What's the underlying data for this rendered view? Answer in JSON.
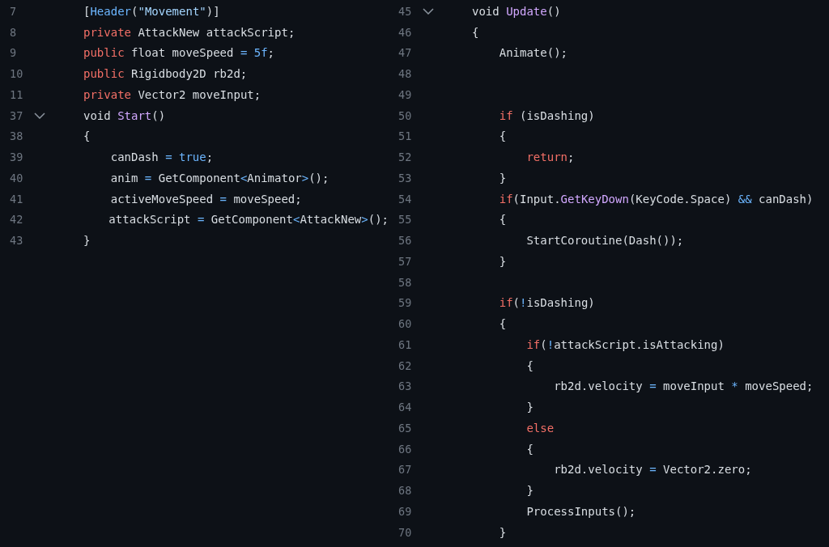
{
  "panes": [
    {
      "lines": [
        {
          "number": "7",
          "tokens": [
            {
              "kind": "plain",
              "text": "["
            },
            {
              "kind": "type",
              "text": "Header"
            },
            {
              "kind": "plain",
              "text": "("
            },
            {
              "kind": "string",
              "text": "\"Movement\""
            },
            {
              "kind": "plain",
              "text": ")]"
            }
          ]
        },
        {
          "number": "8",
          "tokens": [
            {
              "kind": "keyword",
              "text": "private"
            },
            {
              "kind": "plain",
              "text": " AttackNew attackScript;"
            }
          ]
        },
        {
          "number": "9",
          "tokens": [
            {
              "kind": "keyword",
              "text": "public"
            },
            {
              "kind": "plain",
              "text": " float moveSpeed "
            },
            {
              "kind": "operator",
              "text": "= "
            },
            {
              "kind": "constant",
              "text": "5f"
            },
            {
              "kind": "plain",
              "text": ";"
            }
          ]
        },
        {
          "number": "10",
          "tokens": [
            {
              "kind": "keyword",
              "text": "public"
            },
            {
              "kind": "plain",
              "text": " Rigidbody2D rb2d;"
            }
          ]
        },
        {
          "number": "11",
          "tokens": [
            {
              "kind": "keyword",
              "text": "private"
            },
            {
              "kind": "plain",
              "text": " Vector2 moveInput;"
            }
          ]
        },
        {
          "number": "37",
          "expanded": true,
          "tokens": [
            {
              "kind": "plain",
              "text": "void "
            },
            {
              "kind": "function",
              "text": "Start"
            },
            {
              "kind": "plain",
              "text": "()"
            }
          ]
        },
        {
          "number": "38",
          "tokens": [
            {
              "kind": "plain",
              "text": "{"
            }
          ]
        },
        {
          "number": "39",
          "tokens": [
            {
              "kind": "plain",
              "text": "    canDash "
            },
            {
              "kind": "operator",
              "text": "= "
            },
            {
              "kind": "constant",
              "text": "true"
            },
            {
              "kind": "plain",
              "text": ";"
            }
          ]
        },
        {
          "number": "40",
          "tokens": [
            {
              "kind": "plain",
              "text": "    anim "
            },
            {
              "kind": "operator",
              "text": "="
            },
            {
              "kind": "plain",
              "text": " GetComponent"
            },
            {
              "kind": "operator",
              "text": "<"
            },
            {
              "kind": "plain",
              "text": "Animator"
            },
            {
              "kind": "operator",
              "text": ">"
            },
            {
              "kind": "plain",
              "text": "();"
            }
          ]
        },
        {
          "number": "41",
          "tokens": [
            {
              "kind": "plain",
              "text": "    activeMoveSpeed "
            },
            {
              "kind": "operator",
              "text": "="
            },
            {
              "kind": "plain",
              "text": " moveSpeed;"
            }
          ]
        },
        {
          "number": "42",
          "tokens": [
            {
              "kind": "plain",
              "text": "    attackScript "
            },
            {
              "kind": "operator",
              "text": "="
            },
            {
              "kind": "plain",
              "text": " GetComponent"
            },
            {
              "kind": "operator",
              "text": "<"
            },
            {
              "kind": "plain",
              "text": "AttackNew"
            },
            {
              "kind": "operator",
              "text": ">"
            },
            {
              "kind": "plain",
              "text": "();"
            }
          ]
        },
        {
          "number": "43",
          "tokens": [
            {
              "kind": "plain",
              "text": "}"
            }
          ]
        }
      ]
    },
    {
      "lines": [
        {
          "number": "45",
          "expanded": true,
          "tokens": [
            {
              "kind": "plain",
              "text": "void "
            },
            {
              "kind": "function",
              "text": "Update"
            },
            {
              "kind": "plain",
              "text": "()"
            }
          ]
        },
        {
          "number": "46",
          "tokens": [
            {
              "kind": "plain",
              "text": "{"
            }
          ]
        },
        {
          "number": "47",
          "tokens": [
            {
              "kind": "plain",
              "text": "    Animate();"
            }
          ]
        },
        {
          "number": "48"
        },
        {
          "number": "49"
        },
        {
          "number": "50",
          "tokens": [
            {
              "kind": "keyword",
              "text": "    if"
            },
            {
              "kind": "plain",
              "text": " (isDashing)"
            }
          ]
        },
        {
          "number": "51",
          "tokens": [
            {
              "kind": "plain",
              "text": "    {"
            }
          ]
        },
        {
          "number": "52",
          "tokens": [
            {
              "kind": "keyword",
              "text": "        return"
            },
            {
              "kind": "plain",
              "text": ";"
            }
          ]
        },
        {
          "number": "53",
          "tokens": [
            {
              "kind": "plain",
              "text": "    }"
            }
          ]
        },
        {
          "number": "54",
          "tokens": [
            {
              "kind": "keyword",
              "text": "    if"
            },
            {
              "kind": "plain",
              "text": "(Input."
            },
            {
              "kind": "function",
              "text": "GetKeyDown"
            },
            {
              "kind": "plain",
              "text": "(KeyCode.Space) "
            },
            {
              "kind": "operator",
              "text": "&&"
            },
            {
              "kind": "plain",
              "text": " canDash)"
            }
          ]
        },
        {
          "number": "55",
          "tokens": [
            {
              "kind": "plain",
              "text": "    {"
            }
          ]
        },
        {
          "number": "56",
          "tokens": [
            {
              "kind": "plain",
              "text": "        StartCoroutine(Dash());"
            }
          ]
        },
        {
          "number": "57",
          "tokens": [
            {
              "kind": "plain",
              "text": "    }"
            }
          ]
        },
        {
          "number": "58"
        },
        {
          "number": "59",
          "tokens": [
            {
              "kind": "keyword",
              "text": "    if"
            },
            {
              "kind": "plain",
              "text": "("
            },
            {
              "kind": "operator",
              "text": "!"
            },
            {
              "kind": "plain",
              "text": "isDashing)"
            }
          ]
        },
        {
          "number": "60",
          "tokens": [
            {
              "kind": "plain",
              "text": "    {"
            }
          ]
        },
        {
          "number": "61",
          "tokens": [
            {
              "kind": "keyword",
              "text": "        if"
            },
            {
              "kind": "plain",
              "text": "("
            },
            {
              "kind": "operator",
              "text": "!"
            },
            {
              "kind": "plain",
              "text": "attackScript.isAttacking)"
            }
          ]
        },
        {
          "number": "62",
          "tokens": [
            {
              "kind": "plain",
              "text": "        {"
            }
          ]
        },
        {
          "number": "63",
          "tokens": [
            {
              "kind": "plain",
              "text": "            rb2d.velocity "
            },
            {
              "kind": "operator",
              "text": "="
            },
            {
              "kind": "plain",
              "text": " moveInput "
            },
            {
              "kind": "operator",
              "text": "*"
            },
            {
              "kind": "plain",
              "text": " moveSpeed;"
            }
          ]
        },
        {
          "number": "64",
          "tokens": [
            {
              "kind": "plain",
              "text": "        }"
            }
          ]
        },
        {
          "number": "65",
          "tokens": [
            {
              "kind": "keyword",
              "text": "        else"
            }
          ]
        },
        {
          "number": "66",
          "tokens": [
            {
              "kind": "plain",
              "text": "        {"
            }
          ]
        },
        {
          "number": "67",
          "tokens": [
            {
              "kind": "plain",
              "text": "            rb2d.velocity "
            },
            {
              "kind": "operator",
              "text": "="
            },
            {
              "kind": "plain",
              "text": " Vector2.zero;"
            }
          ]
        },
        {
          "number": "68",
          "tokens": [
            {
              "kind": "plain",
              "text": "        }"
            }
          ]
        },
        {
          "number": "69",
          "tokens": [
            {
              "kind": "plain",
              "text": "        ProcessInputs();"
            }
          ]
        },
        {
          "number": "70",
          "tokens": [
            {
              "kind": "plain",
              "text": "    }"
            }
          ]
        }
      ]
    }
  ]
}
